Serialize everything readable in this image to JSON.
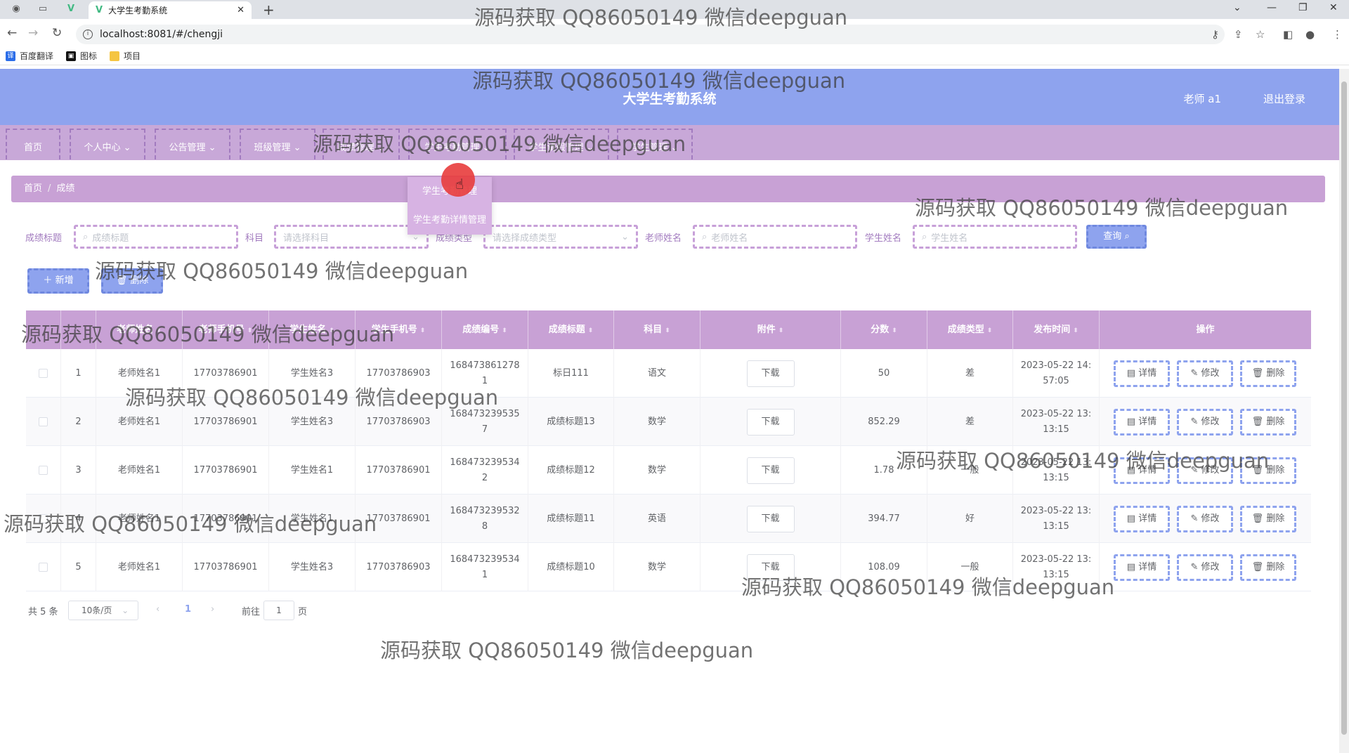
{
  "browser": {
    "tab_title": "大学生考勤系统",
    "url": "localhost:8081/#/chengji",
    "bookmarks": [
      "百度翻译",
      "图标",
      "项目"
    ]
  },
  "header": {
    "title": "大学生考勤系统",
    "user": "老师 a1",
    "logout": "退出登录"
  },
  "menu": [
    "首页",
    "个人中心",
    "公告管理",
    "班级管理",
    "成绩管理",
    "学生考勤管理",
    "学生请假管理",
    "学生管理"
  ],
  "dropdown": [
    "学生考勤管理",
    "学生考勤详情管理"
  ],
  "breadcrumb": [
    "首页",
    "成绩"
  ],
  "search": {
    "title_label": "成绩标题",
    "title_placeholder": "成绩标题",
    "subject_label": "科目",
    "subject_placeholder": "请选择科目",
    "type_label": "成绩类型",
    "type_placeholder": "请选择成绩类型",
    "teacher_label": "老师姓名",
    "teacher_placeholder": "老师姓名",
    "student_label": "学生姓名",
    "student_placeholder": "学生姓名",
    "query": "查询"
  },
  "actions": {
    "add": "新增",
    "delete": "删除"
  },
  "table": {
    "headers": [
      "老师姓名",
      "老师手机号",
      "学生姓名",
      "学生手机号",
      "成绩编号",
      "成绩标题",
      "科目",
      "附件",
      "分数",
      "成绩类型",
      "发布时间",
      "操作"
    ],
    "rows": [
      {
        "idx": "1",
        "teacher": "老师姓名1",
        "tphone": "17703786901",
        "student": "学生姓名3",
        "sphone": "17703786903",
        "no": "1684738612781",
        "title": "标日111",
        "subject": "语文",
        "file": "下载",
        "score": "50",
        "type": "差",
        "time": "2023-05-22 14:57:05"
      },
      {
        "idx": "2",
        "teacher": "老师姓名1",
        "tphone": "17703786901",
        "student": "学生姓名3",
        "sphone": "17703786903",
        "no": "1684732395357",
        "title": "成绩标题13",
        "subject": "数学",
        "file": "下载",
        "score": "852.29",
        "type": "差",
        "time": "2023-05-22 13:13:15"
      },
      {
        "idx": "3",
        "teacher": "老师姓名1",
        "tphone": "17703786901",
        "student": "学生姓名1",
        "sphone": "17703786901",
        "no": "1684732395342",
        "title": "成绩标题12",
        "subject": "数学",
        "file": "下载",
        "score": "1.78",
        "type": "一般",
        "time": "2023-05-22 13:13:15"
      },
      {
        "idx": "4",
        "teacher": "老师姓名1",
        "tphone": "17703786901",
        "student": "学生姓名1",
        "sphone": "17703786901",
        "no": "1684732395328",
        "title": "成绩标题11",
        "subject": "英语",
        "file": "下载",
        "score": "394.77",
        "type": "好",
        "time": "2023-05-22 13:13:15"
      },
      {
        "idx": "5",
        "teacher": "老师姓名1",
        "tphone": "17703786901",
        "student": "学生姓名3",
        "sphone": "17703786903",
        "no": "1684732395341",
        "title": "成绩标题10",
        "subject": "数学",
        "file": "下载",
        "score": "108.09",
        "type": "一般",
        "time": "2023-05-22 13:13:15"
      }
    ],
    "ops": {
      "detail": "详情",
      "edit": "修改",
      "delete": "删除"
    }
  },
  "pagination": {
    "total": "共 5 条",
    "size": "10条/页",
    "page": "1",
    "goto": "前往",
    "goto_value": "1",
    "page_unit": "页"
  },
  "watermark": "源码获取 QQ86050149 微信deepguan"
}
